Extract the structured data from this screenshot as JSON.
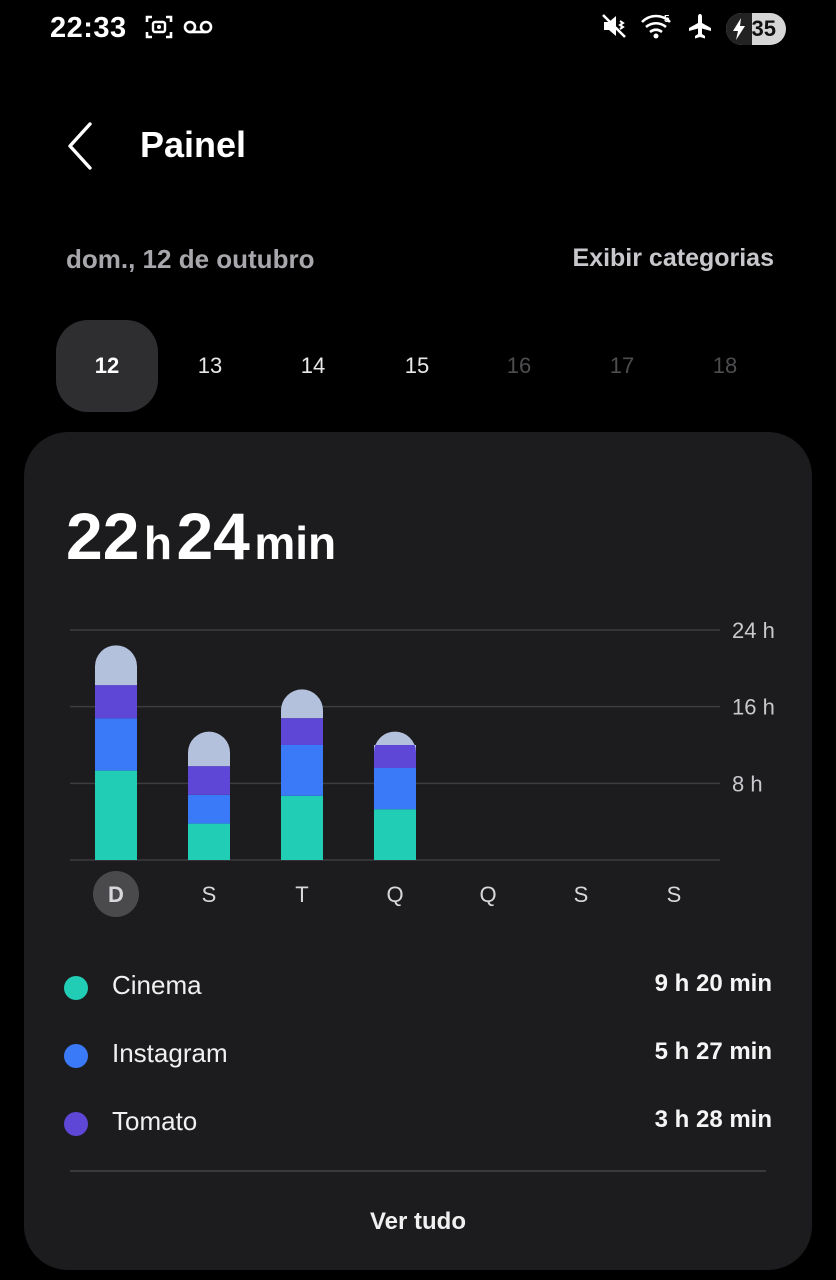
{
  "status_bar": {
    "time": "22:33",
    "battery": "35",
    "icons": [
      "screenshot-icon",
      "voicemail-icon",
      "mute-vibrate-icon",
      "wifi-icon",
      "airplane-icon",
      "battery-charging-icon"
    ]
  },
  "header": {
    "title": "Painel",
    "back_icon": "chevron-left-icon"
  },
  "date_label": "dom., 12 de outubro",
  "show_categories_label": "Exibir categorias",
  "day_selector": [
    {
      "label": "12",
      "state": "selected"
    },
    {
      "label": "13",
      "state": "normal"
    },
    {
      "label": "14",
      "state": "normal"
    },
    {
      "label": "15",
      "state": "normal"
    },
    {
      "label": "16",
      "state": "disabled"
    },
    {
      "label": "17",
      "state": "disabled"
    },
    {
      "label": "18",
      "state": "disabled"
    }
  ],
  "summary": {
    "hours": "22",
    "hours_unit": "h",
    "minutes": "24",
    "minutes_unit": "min"
  },
  "colors": {
    "cinema": "#21cdb4",
    "instagram": "#3a79f7",
    "tomato": "#5e47d6",
    "other": "#b3c1dd",
    "gridline": "#3d3d40",
    "selected_day_badge": "#4a4a4d"
  },
  "chart_data": {
    "type": "bar",
    "stacked": true,
    "categories": [
      "D",
      "S",
      "T",
      "Q",
      "Q",
      "S",
      "S"
    ],
    "selected_category_index": 0,
    "y_ticks": [
      "24 h",
      "16 h",
      "8 h"
    ],
    "ylim": [
      0,
      24
    ],
    "grid": true,
    "series": [
      {
        "name": "Cinema",
        "values": [
          9.33,
          3.8,
          6.7,
          5.3,
          0,
          0,
          0
        ]
      },
      {
        "name": "Instagram",
        "values": [
          5.45,
          3.0,
          5.3,
          4.3,
          0,
          0,
          0
        ]
      },
      {
        "name": "Tomato",
        "values": [
          3.47,
          3.0,
          2.8,
          2.4,
          0,
          0,
          0
        ]
      },
      {
        "name": "",
        "values": [
          4.15,
          3.6,
          3.0,
          1.4,
          0,
          0,
          0
        ]
      }
    ]
  },
  "legend": [
    {
      "name": "Cinema",
      "time": "9 h 20 min",
      "color": "#21cdb4"
    },
    {
      "name": "Instagram",
      "time": "5 h 27 min",
      "color": "#3a79f7"
    },
    {
      "name": "Tomato",
      "time": "3 h 28 min",
      "color": "#5e47d6"
    }
  ],
  "see_all_label": "Ver tudo"
}
